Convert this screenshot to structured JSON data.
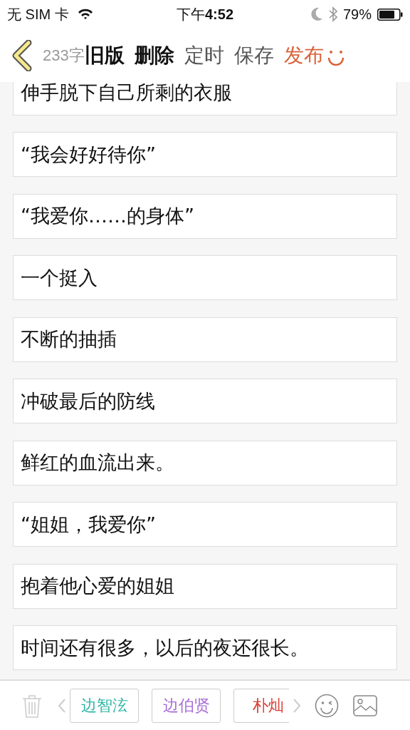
{
  "status_bar": {
    "carrier": "无 SIM 卡",
    "time_prefix": "下午",
    "time": "4:52",
    "battery": "79%"
  },
  "toolbar": {
    "word_count": "233字",
    "actions": [
      {
        "label": "旧版",
        "kind": "strong"
      },
      {
        "label": "删除",
        "kind": "strong"
      },
      {
        "label": "定时",
        "kind": "normal"
      },
      {
        "label": "保存",
        "kind": "normal"
      },
      {
        "label": "发布",
        "kind": "primary"
      }
    ]
  },
  "paragraphs": [
    "伸手脱下自己所剩的衣服",
    "“我会好好待你”",
    "“我爱你……的身体”",
    "一个挺入",
    "不断的抽插",
    "冲破最后的防线",
    "鲜红的血流出来。",
    "“姐姐，我爱你”",
    "抱着他心爱的姐姐",
    "时间还有很多，以后的夜还很长。"
  ],
  "tags": [
    {
      "label": "边智泫",
      "color": "#2fb5a5"
    },
    {
      "label": "边伯贤",
      "color": "#a66cd6"
    },
    {
      "label": "朴灿",
      "color": "#d9443a"
    }
  ]
}
